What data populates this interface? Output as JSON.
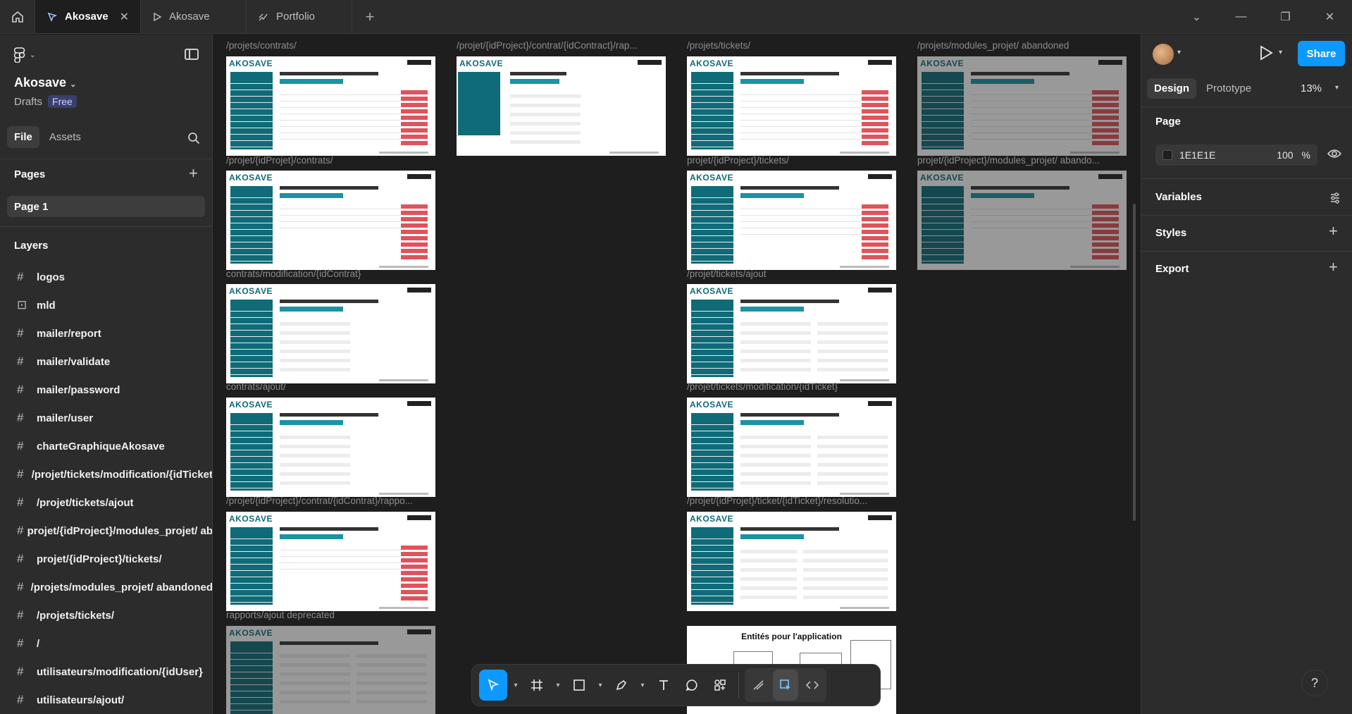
{
  "tabs": {
    "active": "Akosave",
    "second": "Akosave",
    "third": "Portfolio"
  },
  "left_panel": {
    "project_name": "Akosave",
    "drafts_label": "Drafts",
    "plan_badge": "Free",
    "file_tab": "File",
    "assets_tab": "Assets",
    "pages_heading": "Pages",
    "current_page": "Page 1",
    "layers_heading": "Layers",
    "layers": [
      {
        "icon": "frame-icon",
        "label": "logos"
      },
      {
        "icon": "image-icon",
        "label": "mld"
      },
      {
        "icon": "frame-icon",
        "label": "mailer/report"
      },
      {
        "icon": "frame-icon",
        "label": "mailer/validate"
      },
      {
        "icon": "frame-icon",
        "label": "mailer/password"
      },
      {
        "icon": "frame-icon",
        "label": "mailer/user"
      },
      {
        "icon": "frame-icon",
        "label": "charteGraphiqueAkosave"
      },
      {
        "icon": "frame-icon",
        "label": "/projet/tickets/modification/{idTicket"
      },
      {
        "icon": "frame-icon",
        "label": "/projet/tickets/ajout"
      },
      {
        "icon": "frame-icon",
        "label": "projet/{idProject}/modules_projet/  ab"
      },
      {
        "icon": "frame-icon",
        "label": "projet/{idProject}/tickets/"
      },
      {
        "icon": "frame-icon",
        "label": "/projets/modules_projet/  abandoned"
      },
      {
        "icon": "frame-icon",
        "label": "/projets/tickets/"
      },
      {
        "icon": "frame-icon",
        "label": "/"
      },
      {
        "icon": "frame-icon",
        "label": "utilisateurs/modification/{idUser}"
      },
      {
        "icon": "frame-icon",
        "label": "utilisateurs/ajout/"
      }
    ]
  },
  "canvas": {
    "frame_logo": "AKOSAVE",
    "labels": {
      "c1r1": "/projets/contrats/",
      "c2r1": "/projet/{idProject}/contrat/{idContract}/rap...",
      "c3r1": "/projets/tickets/",
      "c4r1": "/projets/modules_projet/  abandoned",
      "c1r2": "/projet/{idProjet}/contrats/",
      "c3r2": "projet/{idProject}/tickets/",
      "c4r2": "projet/{idProject}/modules_projet/  abando...",
      "c1r3": "contrats/modification/{idContrat}",
      "c3r3": "/projet/tickets/ajout",
      "c1r4": "contrats/ajout/",
      "c3r4": "/projet/tickets/modification/{idTicket}",
      "c1r5": "/projet/{idProject}/contrat/{idContrat}/rappo...",
      "c3r5": "/projet/{idProjet}/ticket/{idTicket}/resolutio...",
      "c1r6": "rapports/ajout deprecated"
    },
    "entity_title": "Entités pour l'application"
  },
  "right_panel": {
    "share_label": "Share",
    "design_tab": "Design",
    "prototype_tab": "Prototype",
    "zoom": "13%",
    "page_heading": "Page",
    "bg_color_hex": "1E1E1E",
    "bg_opacity": "100",
    "opacity_unit": "%",
    "variables_heading": "Variables",
    "styles_heading": "Styles",
    "export_heading": "Export"
  },
  "help_label": "?"
}
